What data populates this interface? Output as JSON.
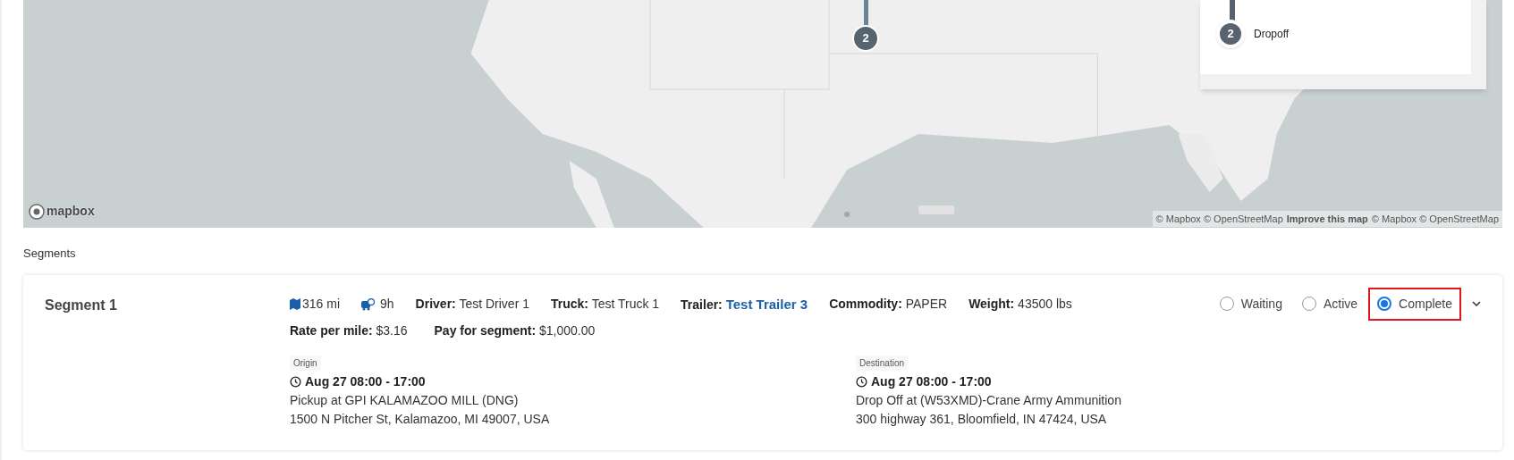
{
  "map": {
    "marker": {
      "number": "2"
    },
    "legend": {
      "stops": [
        {
          "number": "2",
          "label": "Dropoff"
        }
      ]
    },
    "logo_text": "mapbox",
    "attribution": [
      {
        "kind": "text",
        "text": "© Mapbox © OpenStreetMap"
      },
      {
        "kind": "link",
        "text": "Improve this map"
      },
      {
        "kind": "text",
        "text": "© Mapbox © OpenStreetMap"
      }
    ]
  },
  "segments_heading": "Segments",
  "segment": {
    "title": "Segment 1",
    "distance": "316 mi",
    "duration": "9h",
    "fields": [
      {
        "label": "Driver:",
        "value": "Test Driver 1",
        "kind": "text"
      },
      {
        "label": "Truck:",
        "value": "Test Truck 1",
        "kind": "text"
      },
      {
        "label": "Trailer:",
        "value": "Test Trailer 3",
        "kind": "link"
      },
      {
        "label": "Commodity:",
        "value": "PAPER",
        "kind": "text"
      },
      {
        "label": "Weight:",
        "value": "43500 lbs",
        "kind": "text"
      }
    ],
    "fields_row2": [
      {
        "label": "Rate per mile:",
        "value": "$3.16"
      },
      {
        "label": "Pay for segment:",
        "value": "$1,000.00"
      }
    ],
    "statuses": [
      {
        "label": "Waiting",
        "selected": false
      },
      {
        "label": "Active",
        "selected": false
      },
      {
        "label": "Complete",
        "selected": true
      }
    ],
    "stops": [
      {
        "heading": "Origin",
        "time": "Aug 27 08:00 - 17:00",
        "name": "Pickup at GPI KALAMAZOO MILL (DNG)",
        "address": "1500 N Pitcher St, Kalamazoo, MI 49007, USA"
      },
      {
        "heading": "Destination",
        "time": "Aug 27 08:00 - 17:00",
        "name": "Drop Off at (W53XMD)-Crane Army Ammunition",
        "address": "300 highway 361, Bloomfield, IN 47424, USA"
      }
    ]
  }
}
